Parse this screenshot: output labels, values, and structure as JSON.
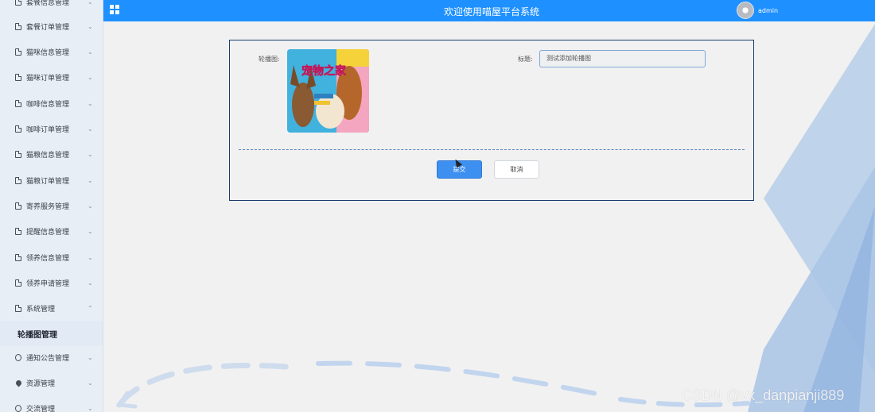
{
  "header": {
    "title": "欢迎使用喵屋平台系统",
    "username": "admin"
  },
  "sidebar": {
    "items": [
      {
        "label": "套餐信息管理"
      },
      {
        "label": "套餐订单管理"
      },
      {
        "label": "猫咪信息管理"
      },
      {
        "label": "猫咪订单管理"
      },
      {
        "label": "咖啡信息管理"
      },
      {
        "label": "咖啡订单管理"
      },
      {
        "label": "猫粮信息管理"
      },
      {
        "label": "猫粮订单管理"
      },
      {
        "label": "寄养服务管理"
      },
      {
        "label": "提醒信息管理"
      },
      {
        "label": "领养信息管理"
      },
      {
        "label": "领养申请管理"
      },
      {
        "label": "系统管理"
      },
      {
        "label": "轮播图管理"
      },
      {
        "label": "通知公告管理"
      },
      {
        "label": "资源管理"
      },
      {
        "label": "交流管理"
      }
    ]
  },
  "form": {
    "banner_label": "轮播图:",
    "banner_image_text": "宠物之家",
    "title_label": "标题:",
    "title_value": "测试添加轮播图",
    "submit_label": "提交",
    "cancel_label": "取消"
  },
  "watermark": "CSDN @vx_danpianji889",
  "colors": {
    "topbar": "#1e90ff",
    "primary_button": "#3d8ff0",
    "sidebar_bg": "#e8eef6"
  }
}
